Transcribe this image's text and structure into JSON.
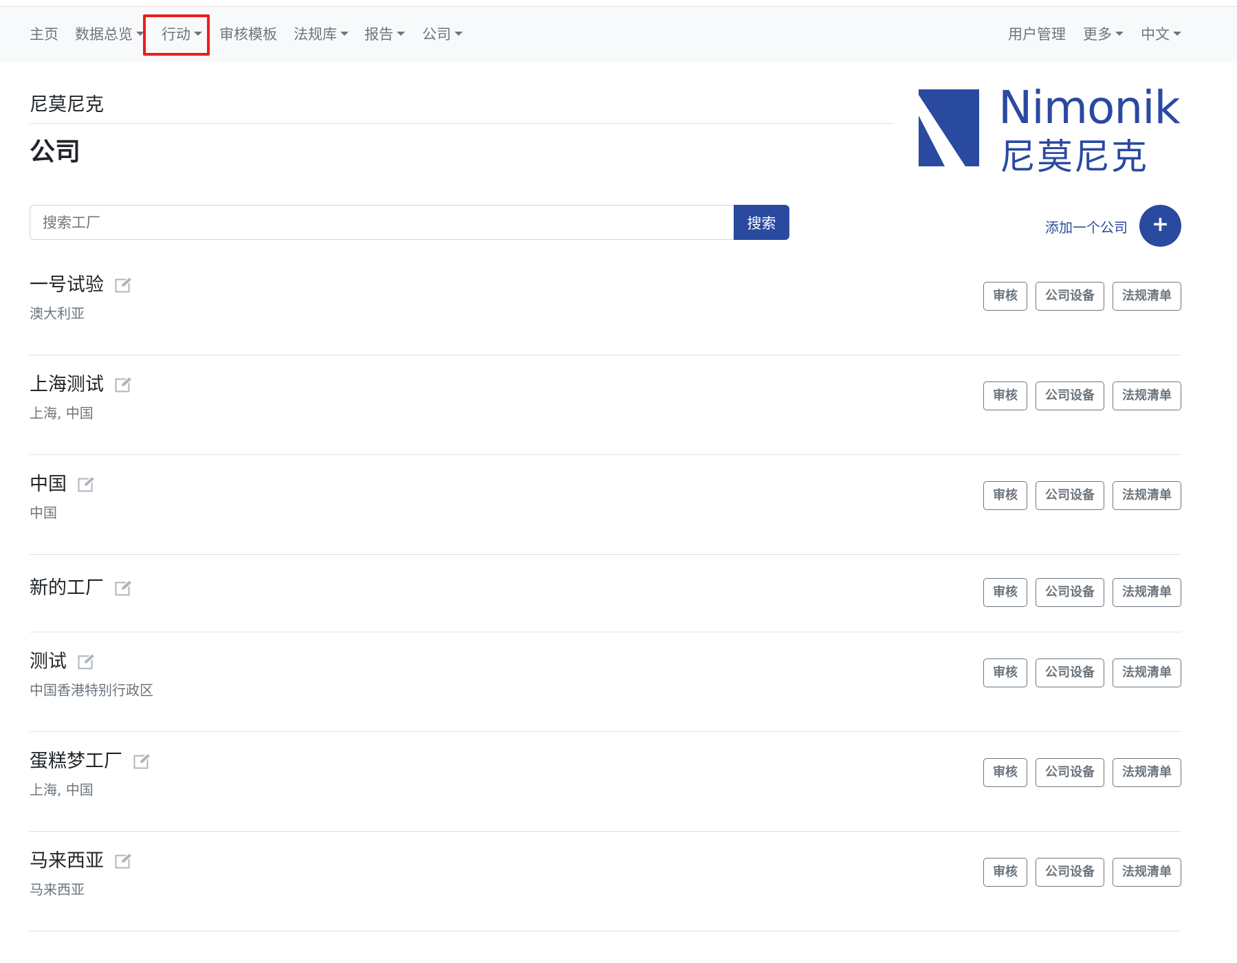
{
  "nav": {
    "home": "主页",
    "dashboard": "数据总览",
    "actions": "行动",
    "audit_templates": "审核模板",
    "regulations": "法规库",
    "reports": "报告",
    "company": "公司",
    "user_management": "用户管理",
    "more": "更多",
    "language": "中文"
  },
  "header": {
    "brand_sub": "尼莫尼克",
    "title": "公司"
  },
  "logo": {
    "text_en": "Nimonik",
    "text_cn": "尼莫尼克",
    "color": "#2a4aa0"
  },
  "search": {
    "placeholder": "搜索工厂",
    "button": "搜索"
  },
  "add_company": {
    "label": "添加一个公司",
    "icon": "+"
  },
  "companies": [
    {
      "name": "一号试验",
      "location": "澳大利亚",
      "audit": "审核",
      "equipment": "公司设备",
      "checklist": "法规清单"
    },
    {
      "name": "上海测试",
      "location": "上海, 中国",
      "audit": "审核",
      "equipment": "公司设备",
      "checklist": "法规清单"
    },
    {
      "name": "中国",
      "location": "中国",
      "audit": "审核",
      "equipment": "公司设备",
      "checklist": "法规清单"
    },
    {
      "name": "新的工厂",
      "location": "",
      "audit": "审核",
      "equipment": "公司设备",
      "checklist": "法规清单"
    },
    {
      "name": "测试",
      "location": "中国香港特别行政区",
      "audit": "审核",
      "equipment": "公司设备",
      "checklist": "法规清单"
    },
    {
      "name": "蛋糕梦工厂",
      "location": "上海, 中国",
      "audit": "审核",
      "equipment": "公司设备",
      "checklist": "法规清单"
    },
    {
      "name": "马来西亚",
      "location": "马来西亚",
      "audit": "审核",
      "equipment": "公司设备",
      "checklist": "法规清单"
    }
  ],
  "colors": {
    "primary": "#2a4aa0",
    "highlight": "#ee1c1c",
    "muted": "#6c757d"
  }
}
